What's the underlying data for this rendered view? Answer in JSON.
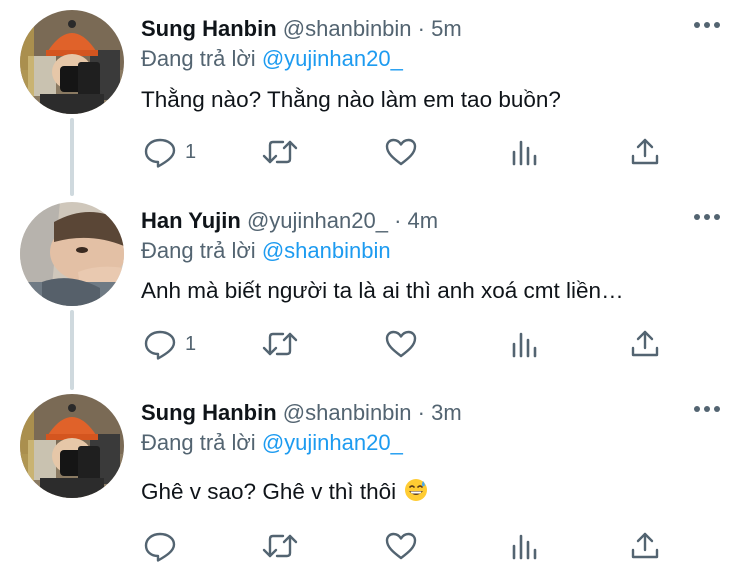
{
  "tweets": [
    {
      "name": "Sung Hanbin",
      "handle": "@shanbinbin",
      "time": "5m",
      "reply_prefix": "Đang trả lời",
      "reply_to": "@yujinhan20_",
      "text": "Thằng nào? Thằng nào làm em tao buồn?",
      "reply_count": "1"
    },
    {
      "name": "Han Yujin",
      "handle": "@yujinhan20_",
      "time": "4m",
      "reply_prefix": "Đang trả lời",
      "reply_to": "@shanbinbin",
      "text": "Anh mà biết người ta là ai thì anh xoá cmt liền…",
      "reply_count": "1"
    },
    {
      "name": "Sung Hanbin",
      "handle": "@shanbinbin",
      "time": "3m",
      "reply_prefix": "Đang trả lời",
      "reply_to": "@yujinhan20_",
      "text": "Ghê v sao? Ghê v thì thôi",
      "emoji": "grinning-face-with-sweat",
      "reply_count": ""
    }
  ],
  "separator": "·",
  "icons": {
    "reply": "reply-icon",
    "retweet": "retweet-icon",
    "like": "heart-icon",
    "views": "analytics-icon",
    "share": "share-icon",
    "more": "more-icon"
  },
  "colors": {
    "text": "#0f1419",
    "secondary": "#536471",
    "mention": "#1d9bf0",
    "thread_line": "#cfd9de"
  }
}
